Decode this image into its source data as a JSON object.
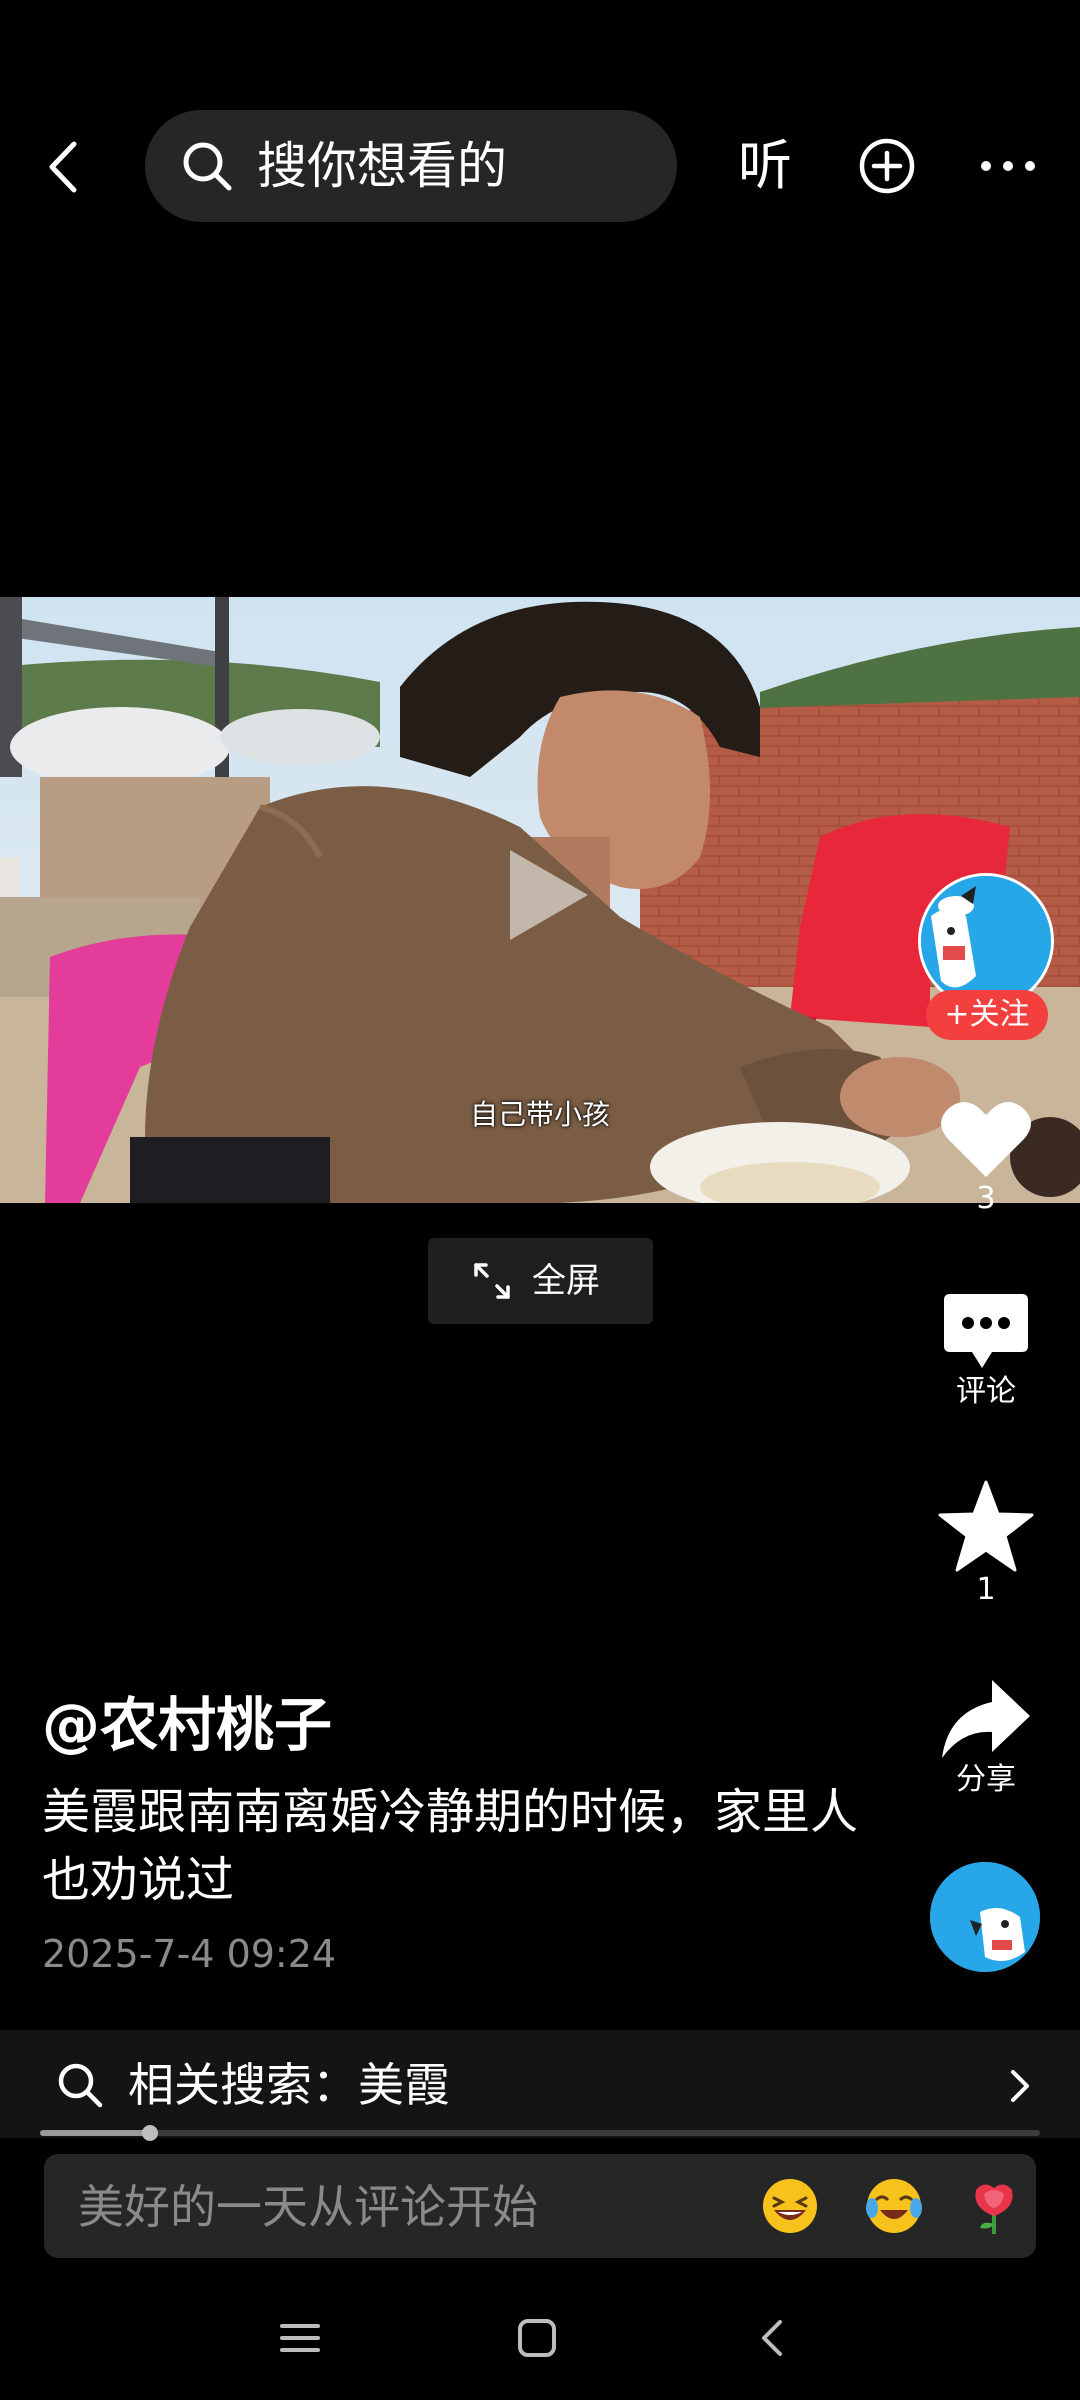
{
  "topbar": {
    "search_placeholder": "搜你想看的",
    "listen_label": "听",
    "icons": [
      "back-icon",
      "search-icon",
      "plus-circle-icon",
      "more-icon"
    ]
  },
  "video": {
    "subtitle": "自己带小孩",
    "fullscreen_label": "全屏"
  },
  "rail": {
    "follow_label": "+关注",
    "like_count": "3",
    "comment_label": "评论",
    "favorite_count": "1",
    "share_label": "分享"
  },
  "post": {
    "author": "@农村桃子",
    "description": "美霞跟南南离婚冷静期的时候，家里人也劝说过",
    "date": "2025-7-4 09:24"
  },
  "related_search": {
    "label": "相关搜索：美霞"
  },
  "playback": {
    "progress": 0.11
  },
  "comment_input": {
    "placeholder": "美好的一天从评论开始",
    "emojis": [
      "laughing-emoji",
      "crying-laughing-emoji",
      "rose-emoji"
    ]
  },
  "navbar": {
    "buttons": [
      "menu-icon",
      "home-icon",
      "back-nav-icon"
    ]
  },
  "colors": {
    "background": "#000000",
    "follow_red": "#f43f3f",
    "avatar_blue": "#27a7e8",
    "date_gray": "#8a8a8a"
  }
}
